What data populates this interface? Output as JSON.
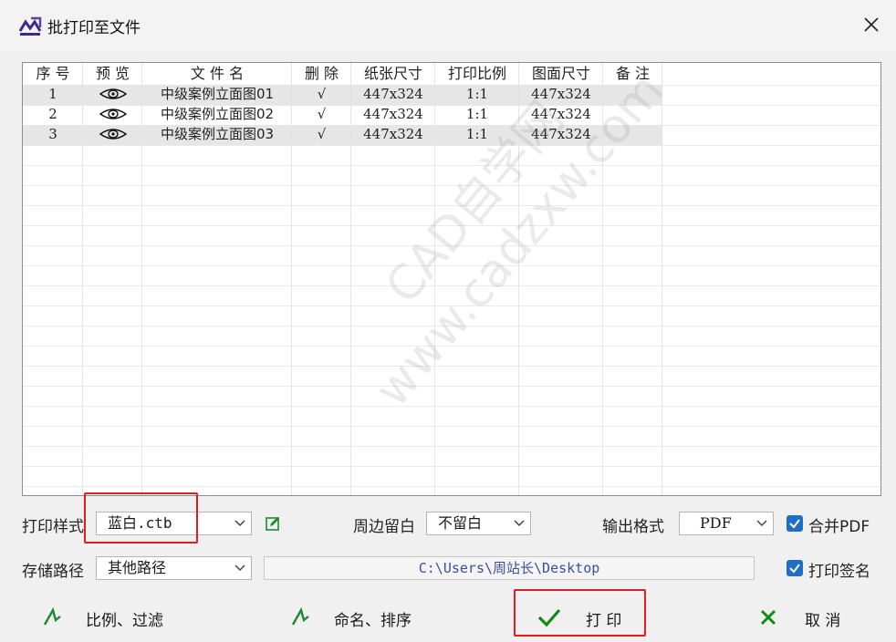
{
  "window": {
    "title": "批打印至文件",
    "icon": "mxsteel-logo-icon",
    "close_icon": "close-icon"
  },
  "table": {
    "columns": [
      "序 号",
      "预 览",
      "文 件 名",
      "删 除",
      "纸张尺寸",
      "打印比例",
      "图面尺寸",
      "备 注"
    ],
    "rows": [
      {
        "no": "1",
        "preview": "eye-icon",
        "name": "中级案例立面图01",
        "delete": "√",
        "paper": "447x324",
        "scale": "1:1",
        "drawing": "447x324",
        "note": ""
      },
      {
        "no": "2",
        "preview": "eye-icon",
        "name": "中级案例立面图02",
        "delete": "√",
        "paper": "447x324",
        "scale": "1:1",
        "drawing": "447x324",
        "note": ""
      },
      {
        "no": "3",
        "preview": "eye-icon",
        "name": "中级案例立面图03",
        "delete": "√",
        "paper": "447x324",
        "scale": "1:1",
        "drawing": "447x324",
        "note": ""
      }
    ]
  },
  "watermark": {
    "line1": "CAD自学网",
    "line2": "www.cadzxw.com"
  },
  "print_style": {
    "label": "打印样式",
    "value": "蓝白.ctb",
    "edit_icon": "edit-icon"
  },
  "margin": {
    "label": "周边留白",
    "value": "不留白"
  },
  "output_format": {
    "label": "输出格式",
    "value": "PDF"
  },
  "merge_pdf": {
    "label": "合并PDF",
    "checked": true
  },
  "save_path": {
    "label": "存储路径",
    "value": "其他路径",
    "path": "C:\\Users\\周站长\\Desktop"
  },
  "print_signature": {
    "label": "打印签名",
    "checked": true
  },
  "buttons": {
    "scale_filter": "比例、过滤",
    "rename_sort": "命名、排序",
    "print": "打  印",
    "cancel": "取  消"
  },
  "colors": {
    "highlight": "#e01e1e",
    "accent": "#1f6fc5",
    "confirm_green": "#138a13"
  }
}
